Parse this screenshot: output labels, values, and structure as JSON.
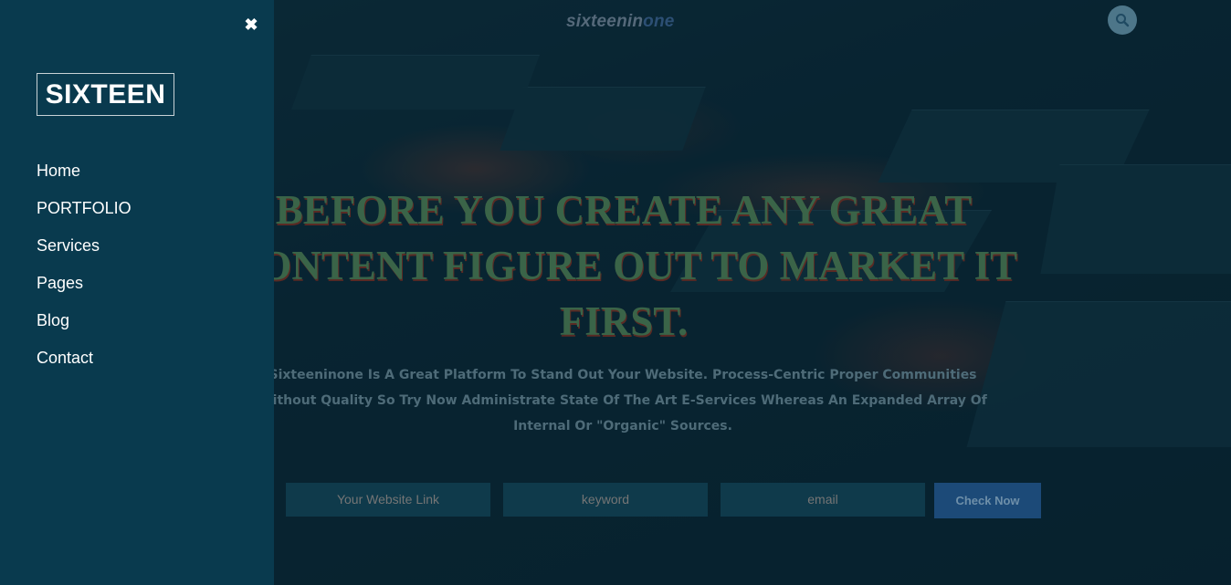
{
  "header": {
    "logo_main": "sixteenin",
    "logo_accent": "one"
  },
  "hero": {
    "headline": "BEFORE YOU CREATE ANY GREAT CONTENT FIGURE OUT TO MARKET IT FIRST.",
    "subtext": "Sixteeninone Is A Great Platform To Stand Out Your Website. Process-Centric Proper Communities Without Quality So Try Now Administrate State Of The Art E-Services Whereas An Expanded Array Of Internal Or \"Organic\" Sources."
  },
  "form": {
    "website_placeholder": "Your Website Link",
    "keyword_placeholder": "keyword",
    "email_placeholder": "email",
    "submit_label": "Check Now"
  },
  "sidebar": {
    "close_icon": "close-icon",
    "brand": "SIXTEEN",
    "items": [
      {
        "label": "Home"
      },
      {
        "label": "PORTFOLIO"
      },
      {
        "label": "Services"
      },
      {
        "label": "Pages"
      },
      {
        "label": "Blog"
      },
      {
        "label": "Contact"
      }
    ]
  },
  "colors": {
    "sidebar_bg": "#093a4e",
    "headline": "#3a6448",
    "button": "#1c4a78"
  }
}
